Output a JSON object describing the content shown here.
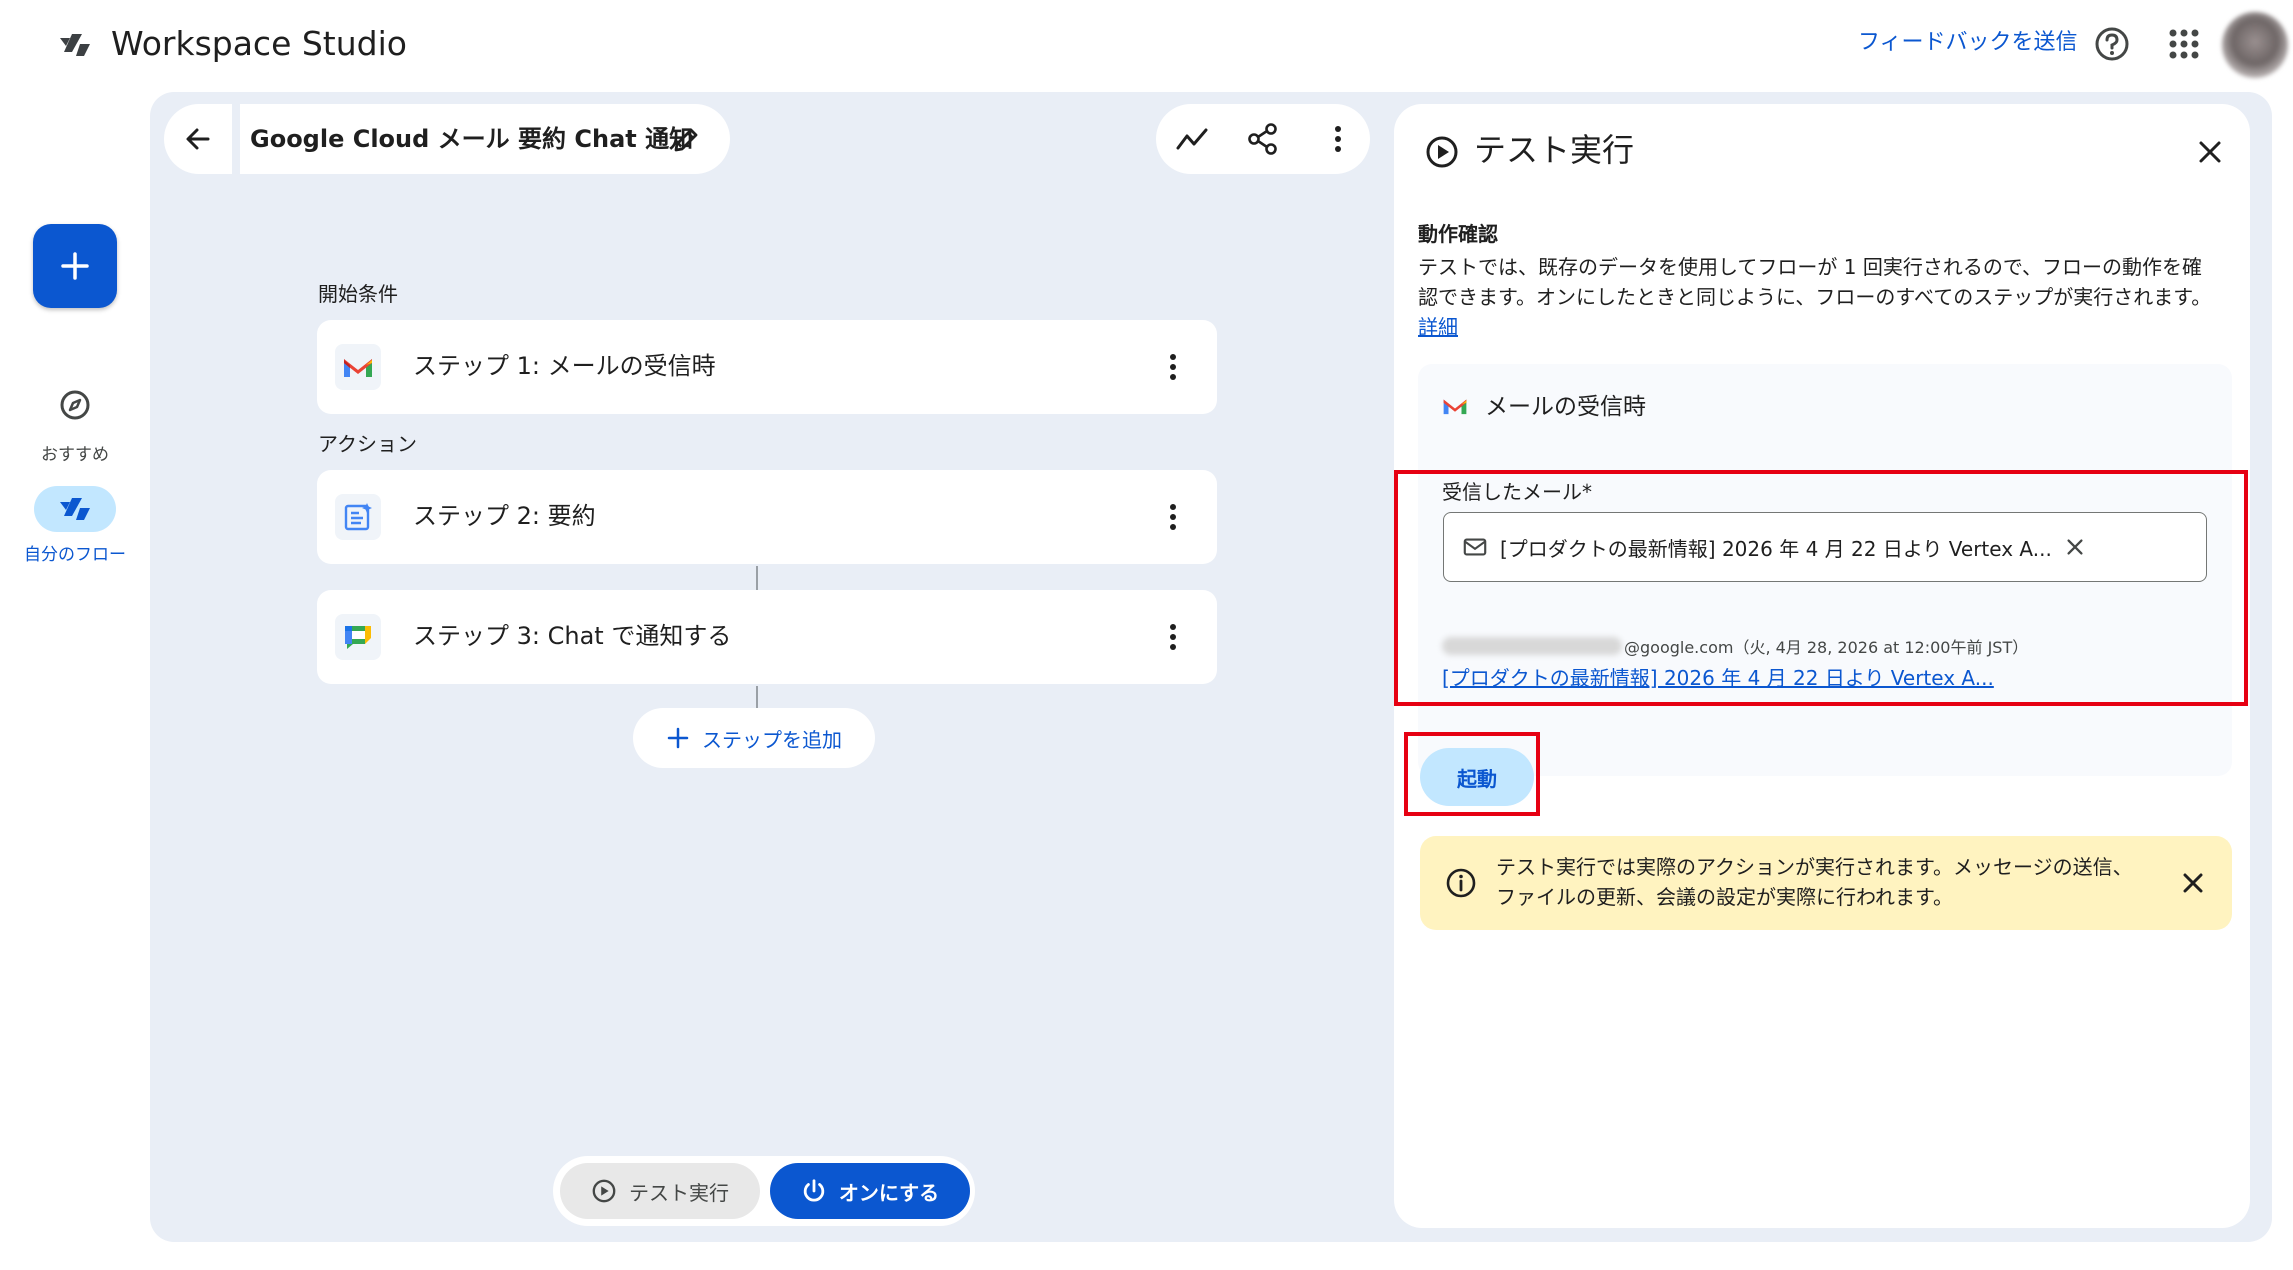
{
  "app": {
    "title": "Workspace Studio"
  },
  "topbar": {
    "feedback_label": "フィードバックを送信"
  },
  "rail": {
    "recommend_label": "おすすめ",
    "myflows_label": "自分のフロー"
  },
  "flow": {
    "title": "Google Cloud メール 要約 Chat 通知",
    "trigger_section": "開始条件",
    "action_section": "アクション",
    "steps": [
      {
        "label": "ステップ 1: メールの受信時",
        "icon": "gmail-icon"
      },
      {
        "label": "ステップ 2: 要約",
        "icon": "summarize-icon"
      },
      {
        "label": "ステップ 3: Chat で通知する",
        "icon": "google-chat-icon"
      }
    ],
    "add_step_label": "ステップを追加"
  },
  "bottom": {
    "test_label": "テスト実行",
    "turn_on_label": "オンにする"
  },
  "panel": {
    "title": "テスト実行",
    "subhead": "動作確認",
    "description": "テストでは、既存のデータを使用してフローが 1 回実行されるので、フローの動作を確認できます。オンにしたときと同じように、フローのすべてのステップが実行されます。",
    "details_link": "詳細",
    "trigger_label": "メールの受信時",
    "field_label": "受信したメール*",
    "chip_text": "[プロダクトの最新情報] 2026 年 4 月 22 日より Vertex A...",
    "sender_meta": "@google.com（火, 4月 28, 2026 at 12:00午前 JST）",
    "subject_link": "[プロダクトの最新情報] 2026 年 4 月 22 日より Vertex A...",
    "start_label": "起動",
    "warning_text": "テスト実行では実際のアクションが実行されます。メッセージの送信、ファイルの更新、会議の設定が実際に行われます。"
  },
  "colors": {
    "accent": "#0b57d0",
    "canvas": "#e9eef6",
    "highlight_box": "#e60012",
    "warning_bg": "#fff3c0"
  }
}
